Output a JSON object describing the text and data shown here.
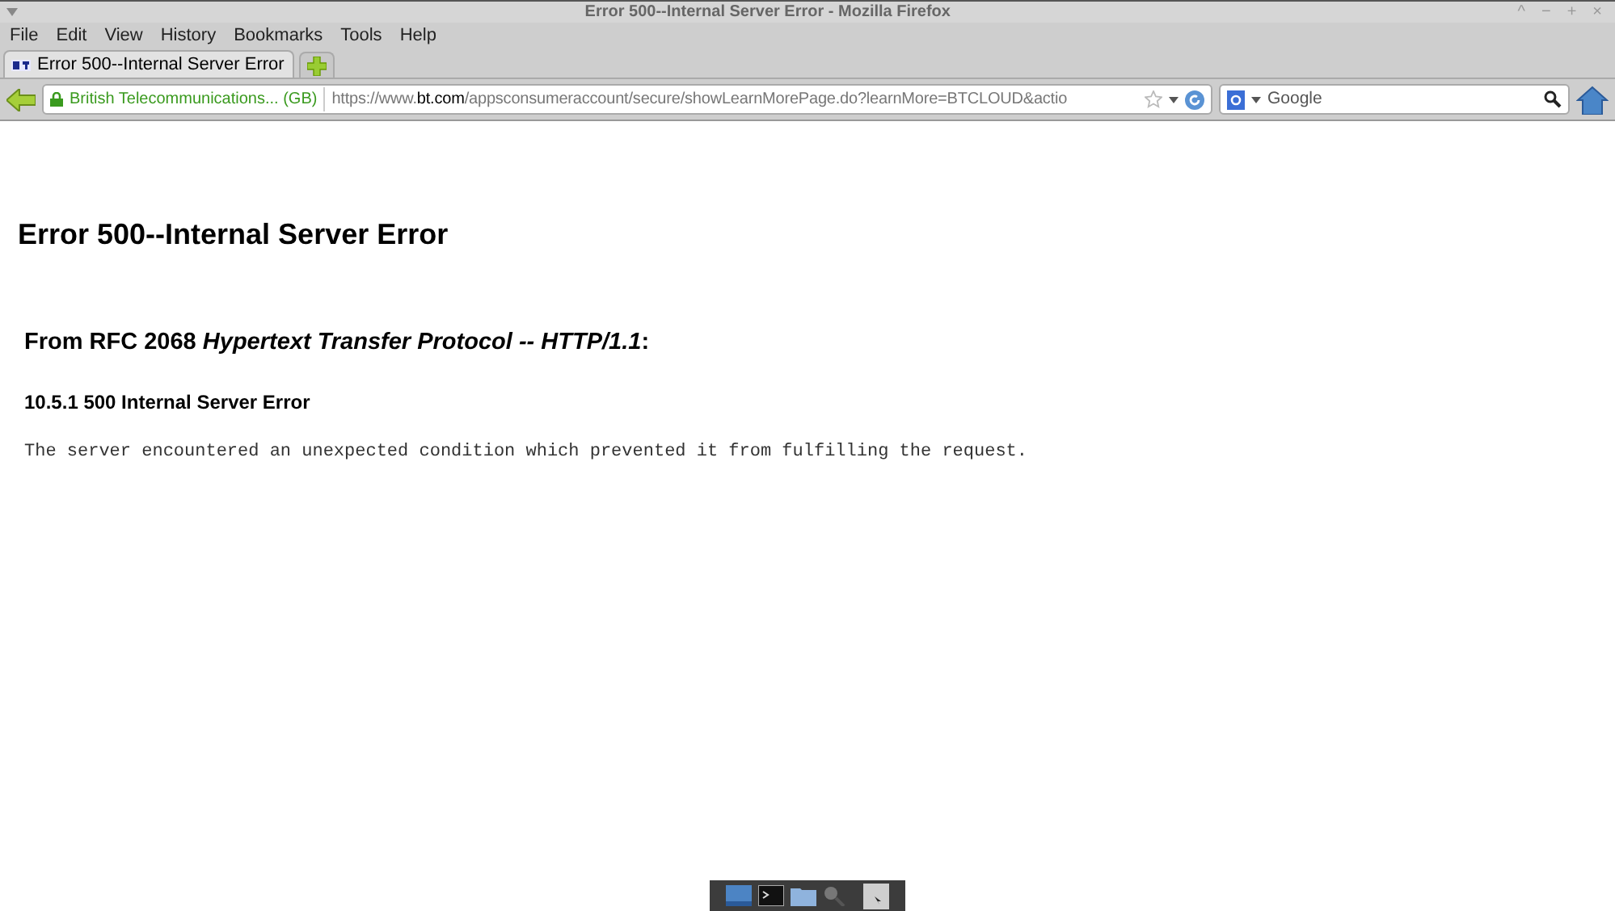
{
  "window": {
    "title": "Error 500--Internal Server Error - Mozilla Firefox",
    "controls": [
      "^",
      "−",
      "+",
      "×"
    ]
  },
  "menu": [
    "File",
    "Edit",
    "View",
    "History",
    "Bookmarks",
    "Tools",
    "Help"
  ],
  "tabs": [
    {
      "label": "Error 500--Internal Server Error",
      "selected": true
    }
  ],
  "nav": {
    "identity": "British Telecommunications... (GB)",
    "url_prefix": "https://www.",
    "url_domain": "bt.com",
    "url_rest": "/appsconsumeraccount/secure/showLearnMorePage.do?learnMore=BTCLOUD&actio",
    "search_placeholder": "Google"
  },
  "page": {
    "heading": "Error 500--Internal Server Error",
    "subheading": "From RFC 2068 *Hypertext Transfer Protocol -- HTTP/1.1*:",
    "section": "10.5.1 500 Internal Server Error",
    "message": "The server encountered an unexpected condition which prevented it from fulfilling the request."
  }
}
